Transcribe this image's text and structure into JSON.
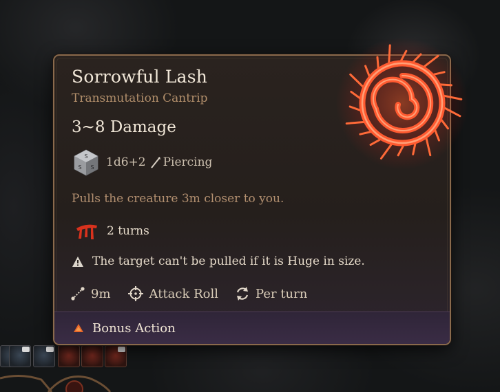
{
  "spell": {
    "name": "Sorrowful Lash",
    "school": "Transmutation Cantrip",
    "damage": "3~8 Damage",
    "dice": "1d6+2",
    "damage_type": "Piercing",
    "description": "Pulls the creature 3m closer to you.",
    "condition": "2 turns",
    "note": "The target can't be pulled if it is Huge in size.",
    "range": "9m",
    "roll": "Attack Roll",
    "recharge": "Per turn",
    "cost": "Bonus Action"
  },
  "icons": {
    "dice": "d6-dice-icon",
    "damage_type": "piercing-icon",
    "condition": "bleeding-icon",
    "note": "warning-icon",
    "range": "range-icon",
    "roll": "target-crosshair-icon",
    "recharge": "recharge-icon",
    "cost": "bonus-action-triangle-icon",
    "emblem": "thorn-spiral-emblem"
  },
  "colors": {
    "accent_red": "#d8321d",
    "bonus_action": "#e8682b",
    "subtitle": "#b28f6b",
    "border": "#8a6a4c"
  }
}
